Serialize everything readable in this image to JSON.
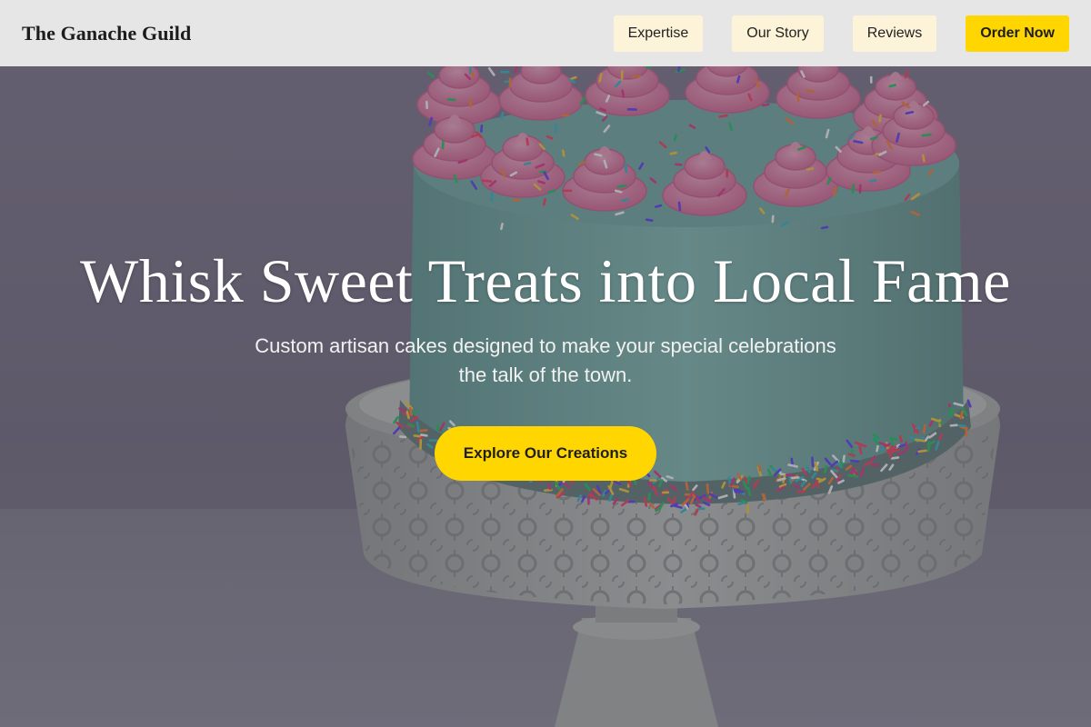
{
  "brand": {
    "name": "The Ganache Guild"
  },
  "nav": {
    "items": [
      {
        "label": "Expertise"
      },
      {
        "label": "Our Story"
      },
      {
        "label": "Reviews"
      }
    ],
    "cta_label": "Order Now"
  },
  "hero": {
    "headline": "Whisk Sweet Treats into Local Fame",
    "subheadline": "Custom artisan cakes designed to make your special celebrations the talk of the town.",
    "cta_label": "Explore Our Creations",
    "image_alt": "Mint green cake with pink frosting swirls and rainbow sprinkles on a white lace cake stand"
  },
  "colors": {
    "accent": "#ffd600",
    "nav_button": "#fcf3d8",
    "navbar_bg": "#e6e6e6"
  }
}
